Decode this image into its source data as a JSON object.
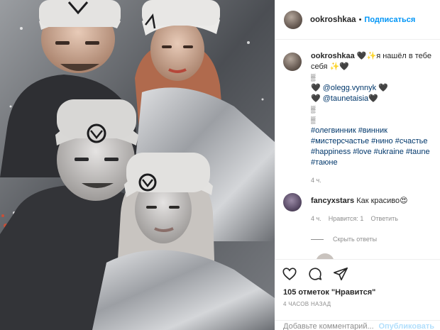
{
  "post": {
    "author": "ookroshkaa",
    "follow_label": "Подписаться",
    "caption": {
      "username": "ookroshkaa",
      "text_1": "🖤✨я нашёл в тебе себя ✨🖤",
      "tiny_1": "▒",
      "mention_1": "@olegg.vynnyk",
      "mention_2": "@taunetaisia",
      "tiny_2": "▒",
      "tiny_3": "▒",
      "hashtags": "#олегвинник #винник #мистерсчастье #нино #счастье #happiness #love #ukraine #taune #таюне",
      "time": "4 ч."
    },
    "comment": {
      "username": "fancyxstars",
      "text": "Как красиво😍",
      "time": "4 ч.",
      "likes": "Нравится: 1",
      "reply": "Ответить",
      "hide_replies": "Скрыть ответы"
    },
    "likes_text": "105 отметок \"Нравится\"",
    "posted_ago": "4 ЧАСОВ НАЗАД",
    "add_comment_placeholder": "Добавьте комментарий...",
    "publish_label": "Опубликовать"
  },
  "colors": {
    "link": "#0095f6",
    "mention": "#00376b",
    "muted": "#8e8e8e"
  }
}
